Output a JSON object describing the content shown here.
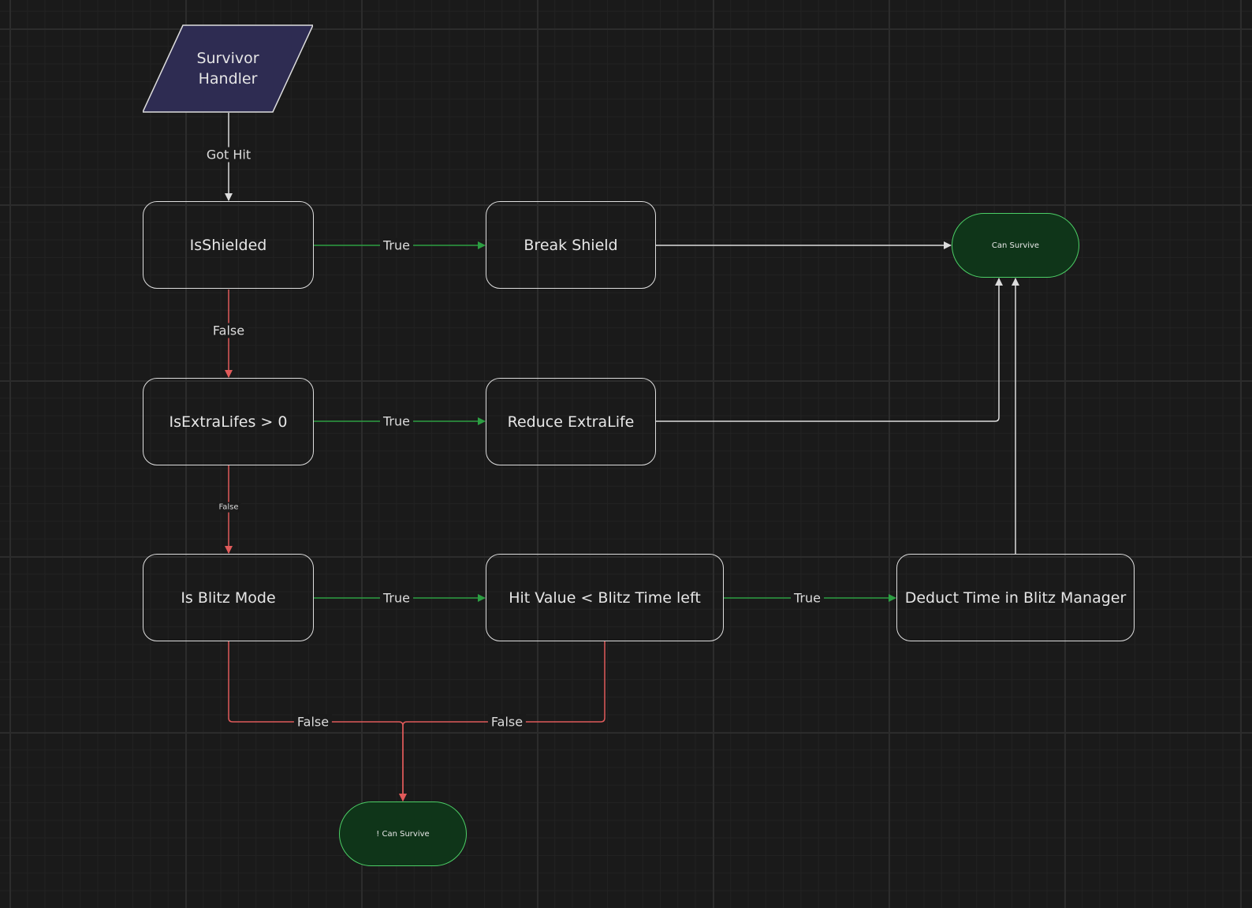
{
  "colors": {
    "background": "#1a1a1a",
    "node_border": "#dedede",
    "input_fill": "#2e2c52",
    "terminal_fill": "#0f3519",
    "terminal_border": "#4ccf66",
    "true_edge": "#2c9e42",
    "false_edge": "#e05a5a",
    "neutral_edge": "#dcdcdc"
  },
  "nodes": {
    "survivor_handler": "Survivor\nHandler",
    "is_shielded": "IsShielded",
    "break_shield": "Break Shield",
    "can_survive": "Can Survive",
    "is_extra_lifes": "IsExtraLifes > 0",
    "reduce_extra_life": "Reduce ExtraLife",
    "is_blitz_mode": "Is Blitz Mode",
    "hit_value_check": "Hit Value < Blitz Time left",
    "deduct_time": "Deduct Time in Blitz Manager",
    "cannot_survive": "! Can Survive"
  },
  "edges": {
    "got_hit": "Got Hit",
    "shielded_true": "True",
    "shielded_false": "False",
    "extra_true": "True",
    "extra_false": "False",
    "blitz_true": "True",
    "hit_true": "True",
    "blitz_false": "False",
    "hit_false": "False"
  }
}
